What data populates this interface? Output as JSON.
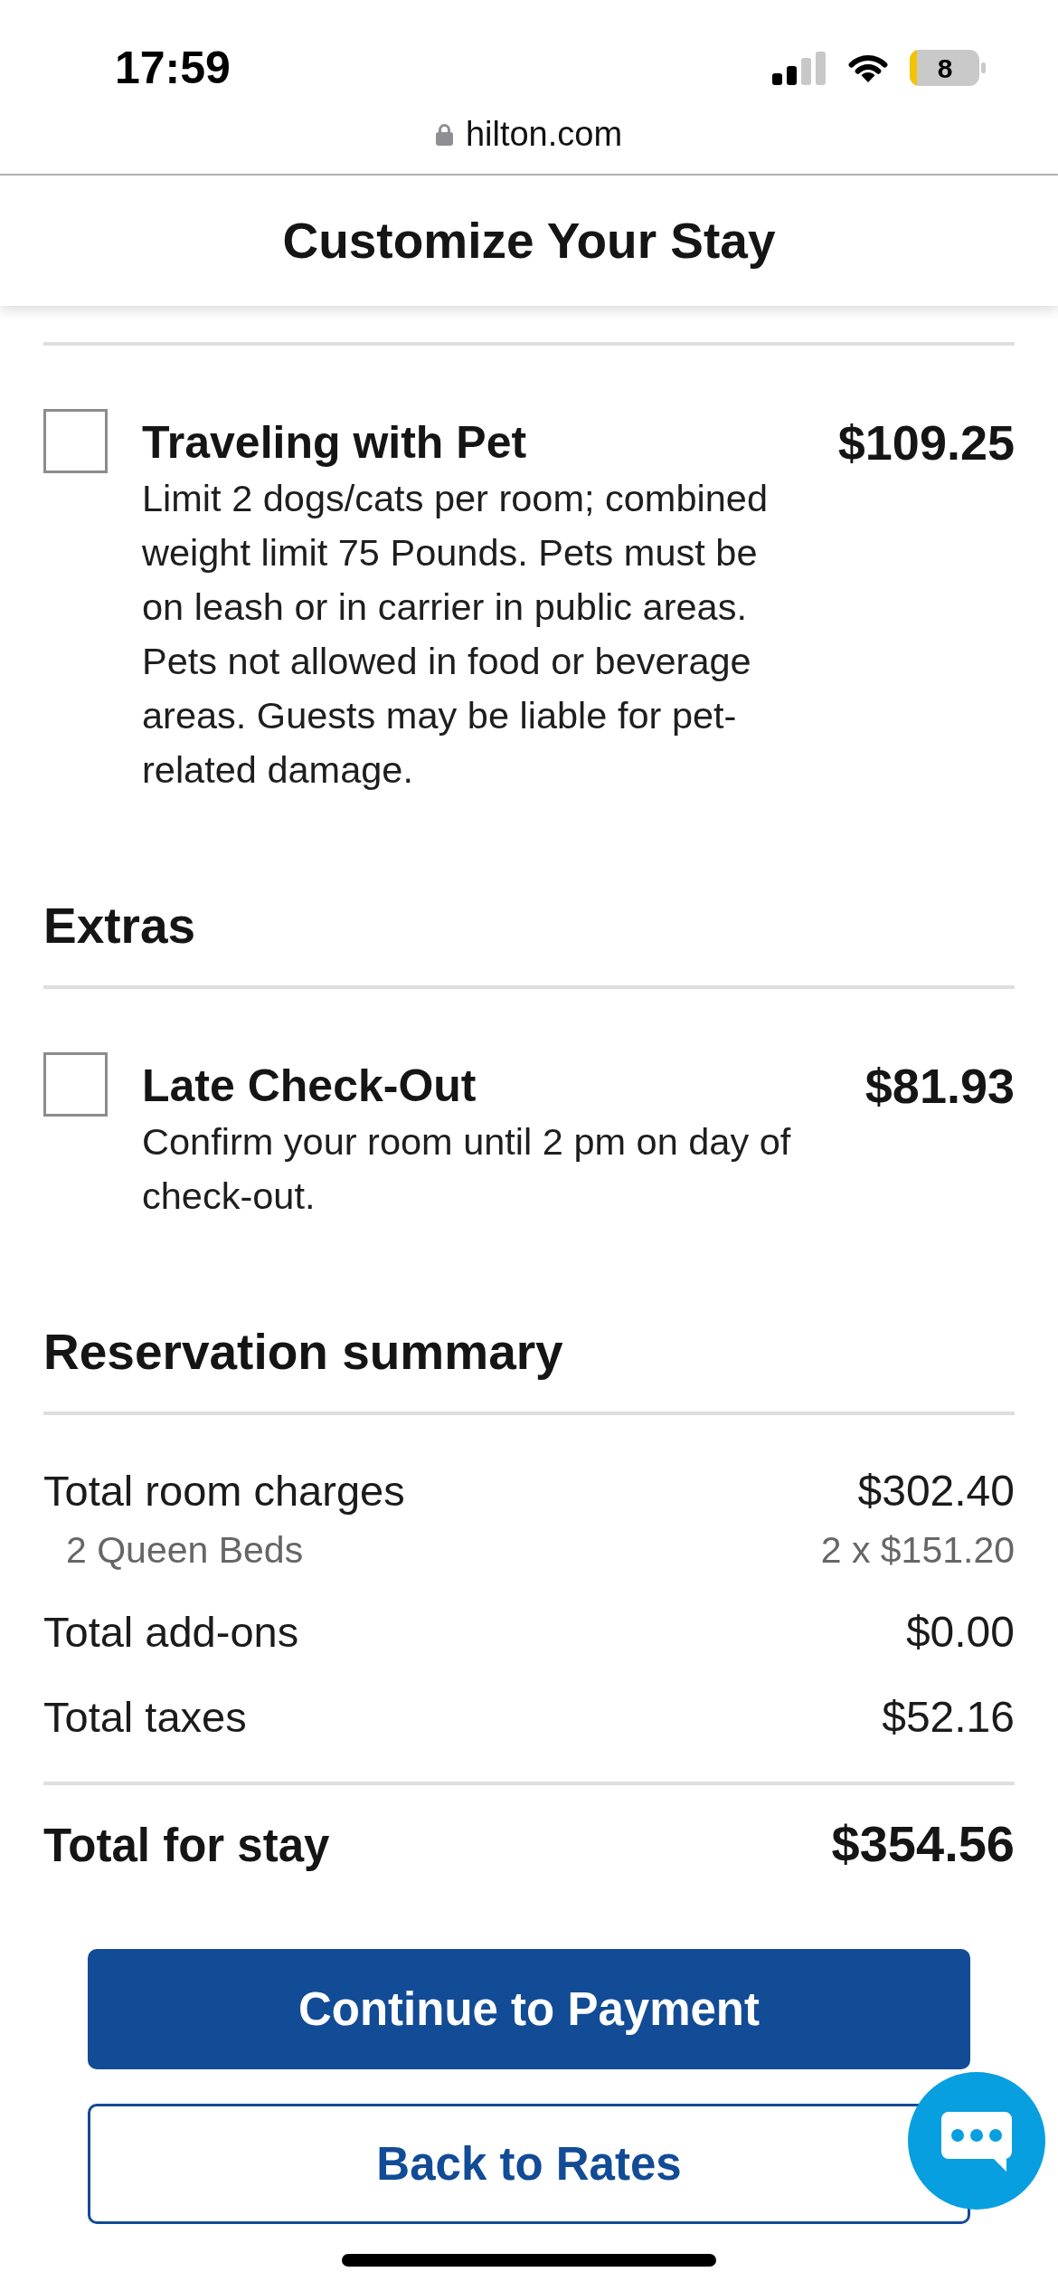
{
  "status_bar": {
    "time": "17:59",
    "battery": "8"
  },
  "browser": {
    "url": "hilton.com"
  },
  "header": {
    "title": "Customize Your Stay"
  },
  "addon_sections": [
    {
      "items": [
        {
          "title": "Traveling with Pet",
          "price": "$109.25",
          "description": "Limit 2 dogs/cats per room; combined weight limit 75 Pounds. Pets must be on leash or in carrier in public areas. Pets not allowed in food or beverage areas. Guests may be liable for pet-related damage.",
          "checked": false
        }
      ]
    },
    {
      "heading": "Extras",
      "items": [
        {
          "title": "Late Check-Out",
          "price": "$81.93",
          "description": "Confirm your room until 2 pm on day of check-out.",
          "checked": false
        }
      ]
    }
  ],
  "summary": {
    "heading": "Reservation summary",
    "lines": [
      {
        "label": "Total room charges",
        "amount": "$302.40",
        "detail_label": "2 Queen Beds",
        "detail_amount": "2 x $151.20"
      },
      {
        "label": "Total add-ons",
        "amount": "$0.00"
      },
      {
        "label": "Total taxes",
        "amount": "$52.16"
      }
    ],
    "total": {
      "label": "Total for stay",
      "amount": "$354.56"
    }
  },
  "buttons": [
    {
      "label": "Continue to Payment",
      "kind": "primary"
    },
    {
      "label": "Back to Rates",
      "kind": "secondary"
    }
  ]
}
